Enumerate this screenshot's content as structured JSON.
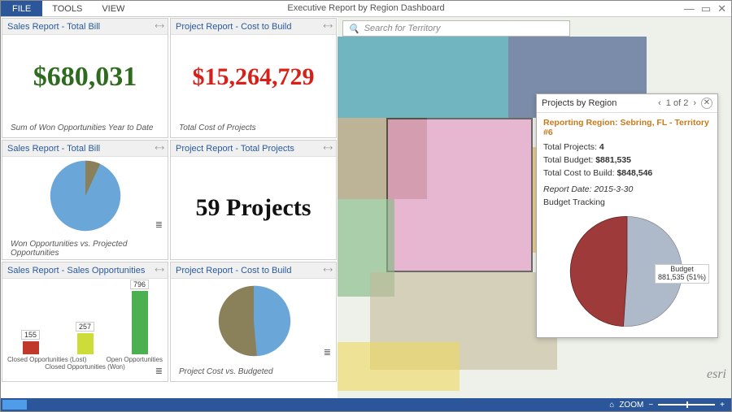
{
  "menu": {
    "file": "FILE",
    "tools": "TOOLS",
    "view": "VIEW"
  },
  "window_title": "Executive Report by Region Dashboard",
  "search": {
    "placeholder": "Search for Territory"
  },
  "panels": {
    "p1": {
      "title": "Sales Report - Total Bill",
      "value": "$680,031",
      "caption": "Sum of Won Opportunities Year to Date"
    },
    "p2": {
      "title": "Project Report - Cost to Build",
      "value": "$15,264,729",
      "caption": "Total Cost of Projects"
    },
    "p3": {
      "title": "Sales Report - Total Bill",
      "caption": "Won Opportunities vs. Projected Opportunities"
    },
    "p4": {
      "title": "Project Report - Total Projects",
      "value": "59 Projects"
    },
    "p5": {
      "title": "Sales Report - Sales Opportunities",
      "axis": {
        "a": "Closed Opportunities (Lost)",
        "b": "Closed Opportunities (Won)",
        "c": "Open Opportunities"
      }
    },
    "p6": {
      "title": "Project Report - Cost to Build",
      "caption": "Project Cost vs. Budgeted"
    }
  },
  "chart_data": {
    "p3_pie": {
      "type": "pie",
      "title": "Won Opportunities vs. Projected Opportunities",
      "series": [
        {
          "name": "Won Opportunities",
          "value": 93,
          "color": "#6aa6d8"
        },
        {
          "name": "Projected Opportunities",
          "value": 7,
          "color": "#8a815a"
        }
      ]
    },
    "p5_bar": {
      "type": "bar",
      "title": "Sales Opportunities",
      "categories": [
        "Closed Opportunities (Lost)",
        "Closed Opportunities (Won)",
        "Open Opportunities"
      ],
      "values": [
        155,
        257,
        796
      ],
      "colors": [
        "#c0392b",
        "#cddc39",
        "#4caf50"
      ],
      "ylim": [
        0,
        800
      ]
    },
    "p6_pie": {
      "type": "pie",
      "title": "Project Cost vs. Budgeted",
      "series": [
        {
          "name": "Project Cost",
          "value": 52,
          "color": "#6aa6d8"
        },
        {
          "name": "Budgeted",
          "value": 48,
          "color": "#8a815a"
        }
      ]
    },
    "popup_pie": {
      "type": "pie",
      "title": "Budget Tracking",
      "series": [
        {
          "name": "Cost to Build",
          "value": 848546,
          "pct": 49,
          "color": "#9e3a3a"
        },
        {
          "name": "Budget",
          "value": 881535,
          "pct": 51,
          "color": "#aeb9c9"
        }
      ],
      "label": {
        "line1": "Budget",
        "line2": "881,535 (51%)"
      }
    }
  },
  "popup": {
    "title": "Projects by Region",
    "pager": "1 of 2",
    "region_name": "Reporting Region: Sebring, FL - Territory #6",
    "rows": {
      "r1_label": "Total Projects:",
      "r1_val": "4",
      "r2_label": "Total Budget:",
      "r2_val": "$881,535",
      "r3_label": "Total Cost to Build:",
      "r3_val": "$848,546"
    },
    "report_date": "Report Date: 2015-3-30",
    "chart_title": "Budget Tracking"
  },
  "status": {
    "zoom_label": "ZOOM"
  },
  "esri": "esri"
}
